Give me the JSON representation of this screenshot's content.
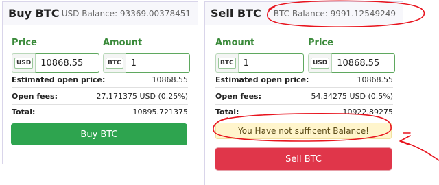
{
  "buy": {
    "title": "Buy BTC",
    "balance": "USD Balance: 93369.00378451",
    "price_label": "Price",
    "price_currency": "USD",
    "price_value": "10868.55",
    "amount_label": "Amount",
    "amount_currency": "BTC",
    "amount_value": "1",
    "estimated_label": "Estimated open price:",
    "estimated_value": "10868.55",
    "fees_label": "Open fees:",
    "fees_value": "27.171375 USD (0.25%)",
    "total_label": "Total:",
    "total_value": "10895.721375",
    "button_label": "Buy BTC"
  },
  "sell": {
    "title": "Sell BTC",
    "balance": "BTC Balance: 9991.12549249",
    "amount_label": "Amount",
    "amount_currency": "BTC",
    "amount_value": "1",
    "price_label": "Price",
    "price_currency": "USD",
    "price_value": "10868.55",
    "estimated_label": "Estimated open price:",
    "estimated_value": "10868.55",
    "fees_label": "Open fees:",
    "fees_value": "54.34275 USD (0.5%)",
    "total_label": "Total:",
    "total_value": "10922.89275",
    "warning": "You Have not sufficent Balance!",
    "button_label": "Sell BTC"
  },
  "colors": {
    "buy_button": "#2ea44f",
    "sell_button": "#e0364a",
    "label_green": "#3a8a3a",
    "warning_bg": "#fff5cc",
    "annotation_red": "#e8141e"
  }
}
